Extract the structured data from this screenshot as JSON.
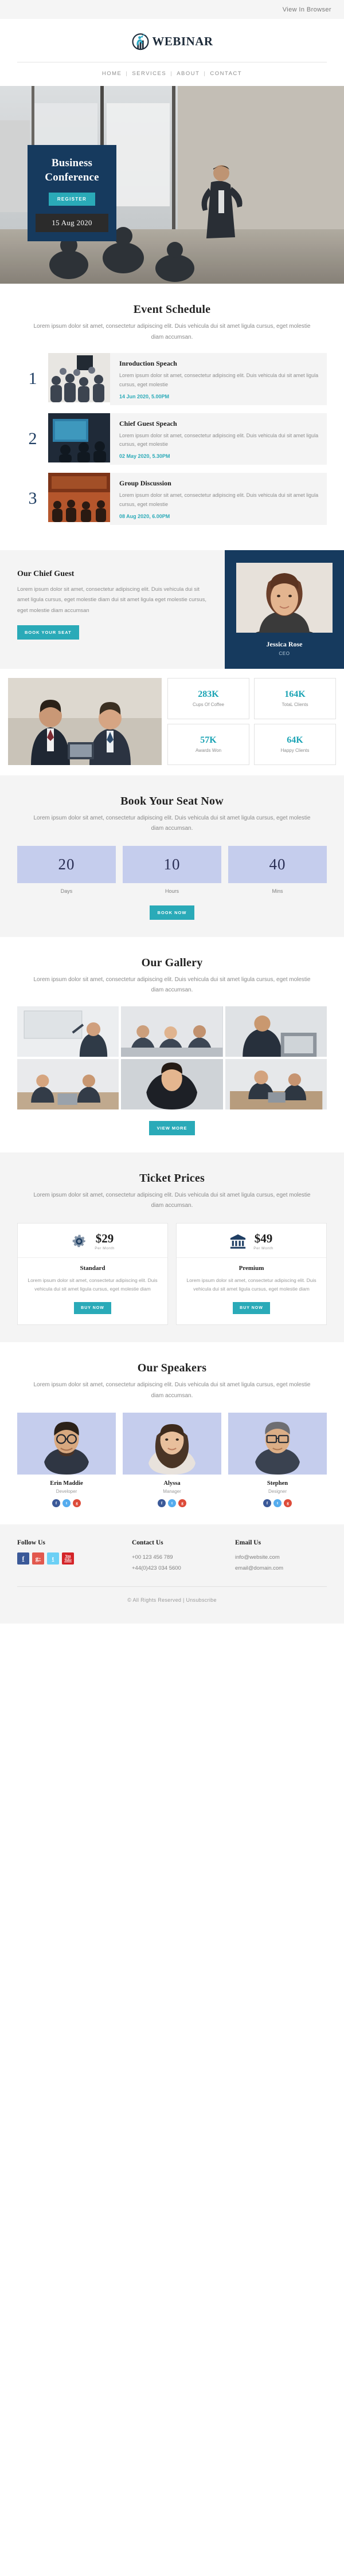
{
  "preheader": {
    "view_in_browser": "View In Browser"
  },
  "brand": {
    "name": "WEBINAR",
    "logo_icon": "webinar-person-chart-logo"
  },
  "nav": {
    "items": [
      "HOME",
      "SERVICES",
      "ABOUT",
      "CONTACT"
    ],
    "separator": "|"
  },
  "hero": {
    "title_line1": "Business",
    "title_line2": "Conference",
    "register_label": "REGISTER",
    "date": "15 Aug 2020"
  },
  "schedule": {
    "title": "Event Schedule",
    "subtitle": "Lorem ipsum dolor sit amet, consectetur adipiscing elit. Duis vehicula dui sit amet ligula cursus, eget molestie diam accumsan.",
    "items": [
      {
        "number": "1",
        "heading": "Inroduction Speach",
        "body": "Lorem ipsum dolor sit amet, consectetur adipiscing elit. Duis vehicula dui sit amet ligula cursus, eget molestie",
        "datetime": "14 Jun 2020, 5.00PM"
      },
      {
        "number": "2",
        "heading": "Chief Guest Speach",
        "body": "Lorem ipsum dolor sit amet, consectetur adipiscing elit. Duis vehicula dui sit amet ligula cursus, eget molestie",
        "datetime": "02 May 2020, 5.30PM"
      },
      {
        "number": "3",
        "heading": "Group Discussion",
        "body": "Lorem ipsum dolor sit amet, consectetur adipiscing elit. Duis vehicula dui sit amet ligula cursus, eget molestie",
        "datetime": "08 Aug 2020, 6.00PM"
      }
    ]
  },
  "chief_guest": {
    "title": "Our Chief Guest",
    "body": "Lorem ipsum dolor sit amet, consectetur adipiscing elit. Duis vehicula dui sit amet ligula cursus, eget molestie diam dui sit amet ligula eget molestie cursus, eget molestie diam accumsan",
    "button_label": "BOOK YOUR SEAT",
    "name": "Jessica Rose",
    "role": "CEO"
  },
  "stats": [
    {
      "value": "283K",
      "label": "Cups Of Coffee"
    },
    {
      "value": "164K",
      "label": "TotaL Clients"
    },
    {
      "value": "57K",
      "label": "Awards Won"
    },
    {
      "value": "64K",
      "label": "Happy Clients"
    }
  ],
  "countdown": {
    "title": "Book Your Seat Now",
    "subtitle": "Lorem ipsum dolor sit amet, consectetur adipiscing elit. Duis vehicula dui sit amet ligula cursus, eget molestie diam accumsan.",
    "units": [
      {
        "value": "20",
        "label": "Days"
      },
      {
        "value": "10",
        "label": "Hours"
      },
      {
        "value": "40",
        "label": "Mins"
      }
    ],
    "button_label": "BOOK NOW"
  },
  "gallery": {
    "title": "Our Gallery",
    "subtitle": "Lorem ipsum dolor sit amet, consectetur adipiscing elit. Duis vehicula dui sit amet ligula cursus, eget molestie diam accumsan.",
    "button_label": "VIEW MORE"
  },
  "tickets": {
    "title": "Ticket Prices",
    "subtitle": "Lorem ipsum dolor sit amet, consectetur adipiscing elit. Duis vehicula dui sit amet ligula cursus, eget molestie diam accumsan.",
    "plans": [
      {
        "icon": "gear-cog-icon",
        "price": "$29",
        "per": "Per Month",
        "tier": "Standard",
        "body": "Lorem ipsum dolor sit amet, consectetur adipiscing elit. Duis vehicula dui sit amet ligula cursus, eget molestie diam",
        "button_label": "BUY NOW"
      },
      {
        "icon": "bank-building-icon",
        "price": "$49",
        "per": "Per Month",
        "tier": "Premium",
        "body": "Lorem ipsum dolor sit amet, consectetur adipiscing elit. Duis vehicula dui sit amet ligula cursus, eget molestie diam",
        "button_label": "BUY NOW"
      }
    ]
  },
  "speakers": {
    "title": "Our Speakers",
    "subtitle": "Lorem ipsum dolor sit amet, consectetur adipiscing elit. Duis vehicula dui sit amet ligula cursus, eget molestie diam accumsan.",
    "people": [
      {
        "name": "Erin Maddie",
        "role": "Developer",
        "socials": [
          "f",
          "t",
          "g"
        ]
      },
      {
        "name": "Alyssa",
        "role": "Manager",
        "socials": [
          "f",
          "t",
          "g"
        ]
      },
      {
        "name": "Stephen",
        "role": "Designer",
        "socials": [
          "f",
          "t",
          "g"
        ]
      }
    ]
  },
  "footer": {
    "follow_heading": "Follow Us",
    "social_icons": [
      "facebook-icon",
      "google-plus-icon",
      "twitter-icon",
      "youtube-icon"
    ],
    "contact_heading": "Contact Us",
    "phones": [
      "+00 123 456 789",
      "+44(0)423 034 5600"
    ],
    "email_heading": "Email Us",
    "emails": [
      "info@website.com",
      "email@domain.com"
    ],
    "copyright": "© All Rights Reserved  |  ",
    "unsubscribe": "Unsubscribe"
  },
  "colors": {
    "accent_teal": "#2aaab8",
    "navy": "#163a5e",
    "periwinkle": "#c5cded",
    "grey_bg": "#f4f4f4"
  }
}
